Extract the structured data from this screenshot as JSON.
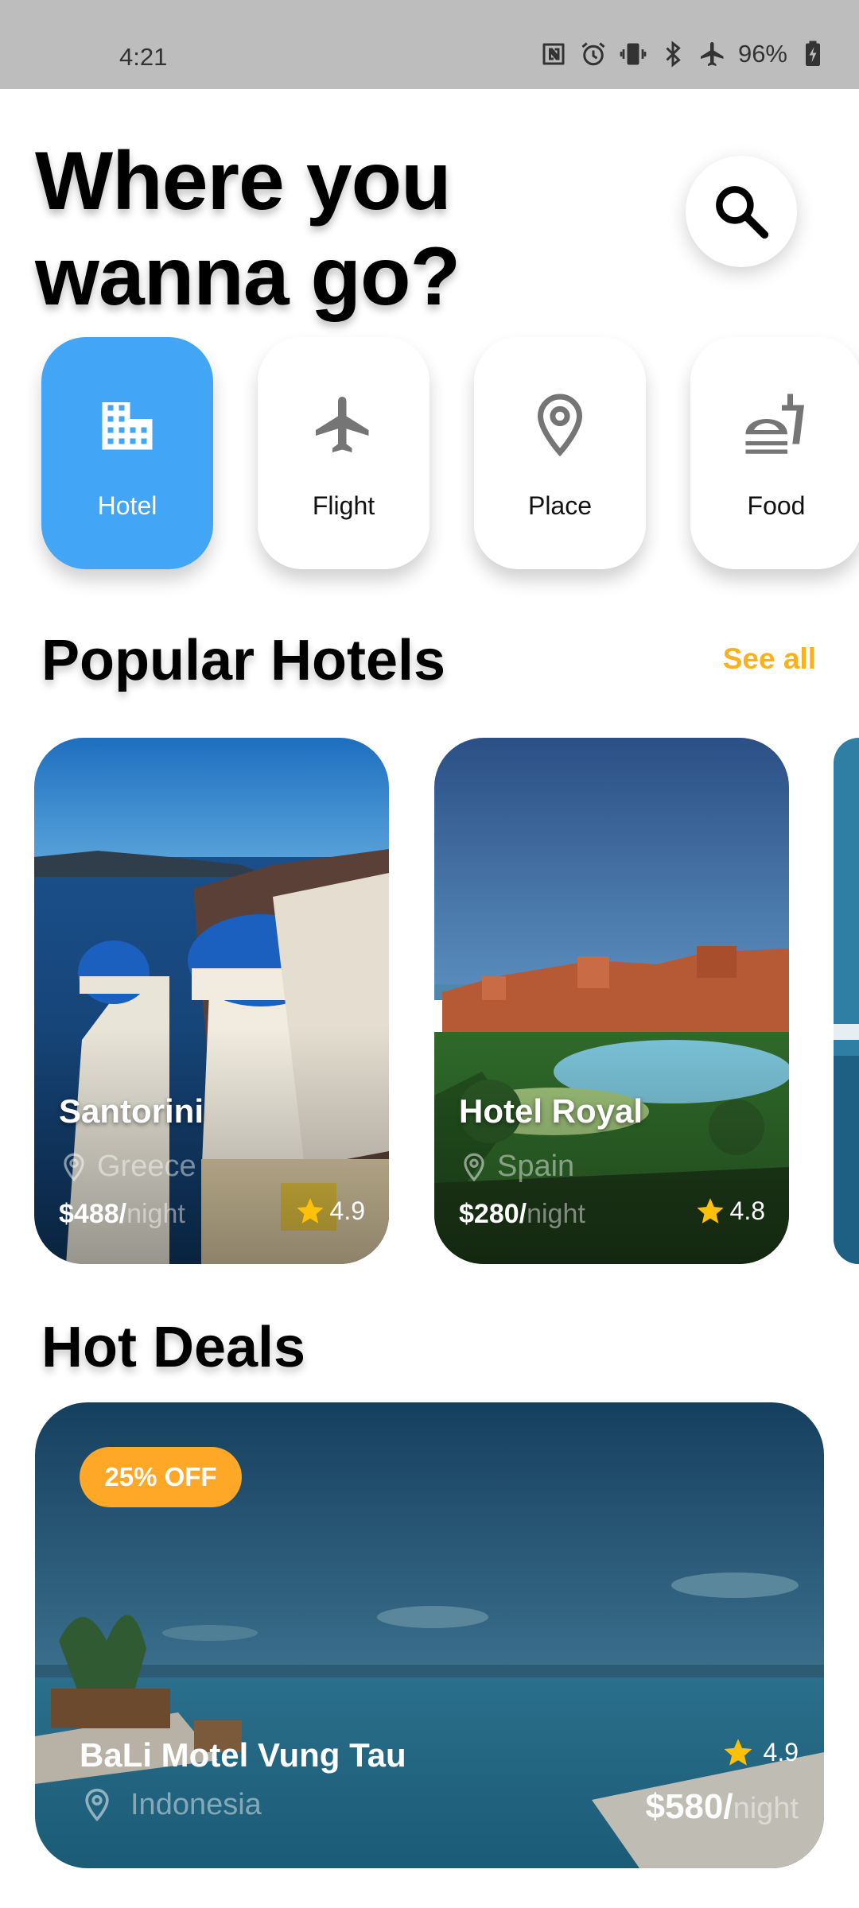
{
  "status_bar": {
    "time": "4:21",
    "battery": "96%",
    "icons": [
      "nfc-icon",
      "alarm-icon",
      "vibrate-icon",
      "bluetooth-icon",
      "airplane-mode-icon",
      "battery-charging-icon"
    ]
  },
  "header": {
    "title_line1": "Where you",
    "title_line2": "wanna go?",
    "search_icon": "search-icon"
  },
  "categories": [
    {
      "label": "Hotel",
      "icon": "hotel-icon",
      "active": true
    },
    {
      "label": "Flight",
      "icon": "airplane-icon",
      "active": false
    },
    {
      "label": "Place",
      "icon": "location-pin-icon",
      "active": false
    },
    {
      "label": "Food",
      "icon": "fastfood-icon",
      "active": false
    }
  ],
  "popular": {
    "title": "Popular Hotels",
    "see_all": "See all",
    "hotels": [
      {
        "name": "Santorini",
        "location": "Greece",
        "price": "$488/",
        "per": "night",
        "rating": "4.9"
      },
      {
        "name": "Hotel Royal",
        "location": "Spain",
        "price": "$280/",
        "per": "night",
        "rating": "4.8"
      }
    ]
  },
  "deals": {
    "title": "Hot Deals",
    "items": [
      {
        "badge": "25% OFF",
        "name": "BaLi Motel Vung Tau",
        "location": "Indonesia",
        "price": "$580/",
        "per": "night",
        "rating": "4.9"
      }
    ]
  },
  "colors": {
    "accent_blue": "#42a5f5",
    "see_all_yellow": "#f9b11e",
    "badge_orange": "#ffa726",
    "star_yellow": "#ffc107",
    "status_bar_gray": "#bdbdbd"
  }
}
